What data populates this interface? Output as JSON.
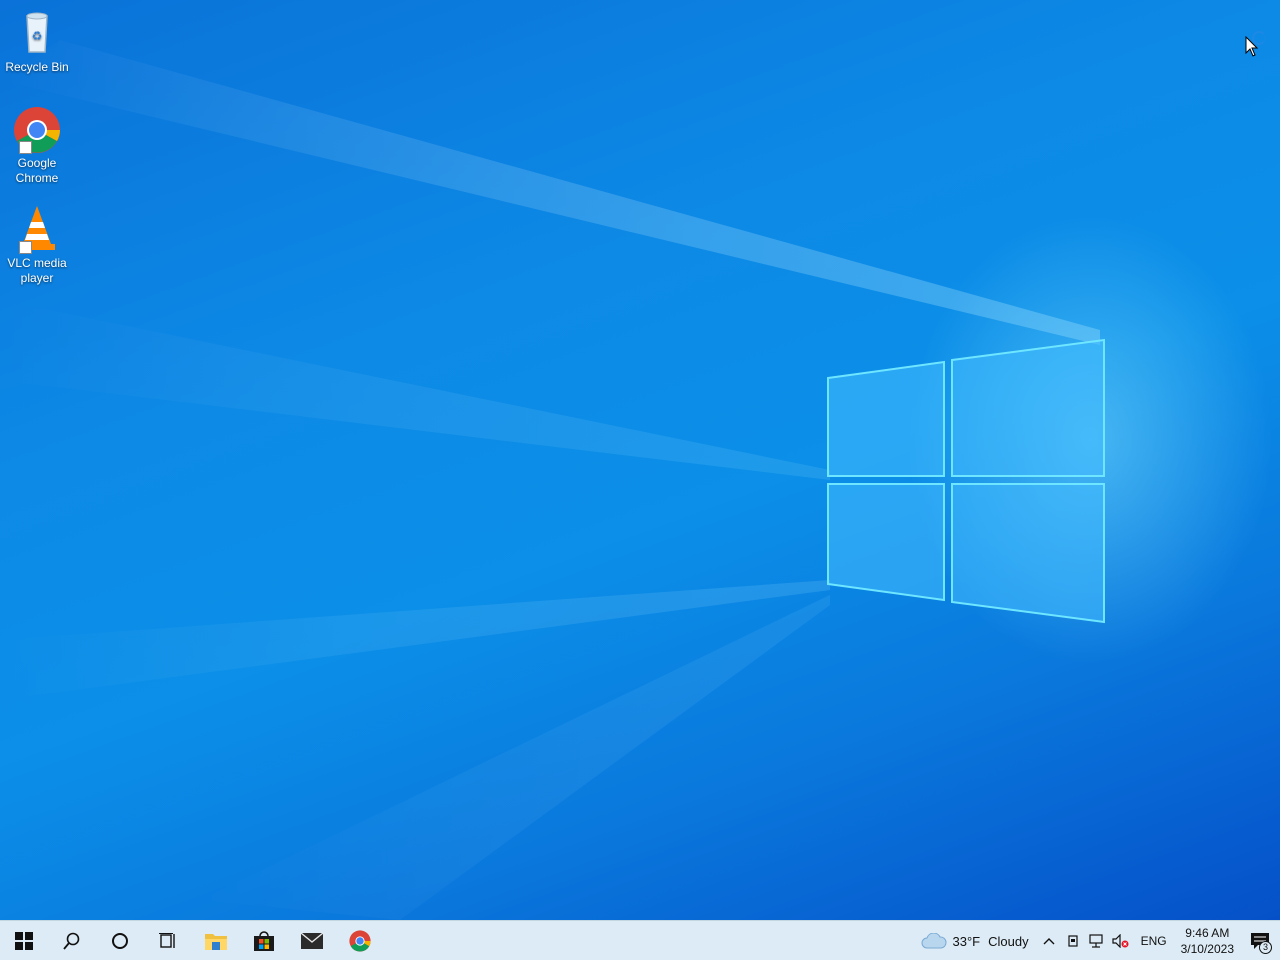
{
  "desktop": {
    "icons": [
      {
        "label": "Recycle Bin",
        "icon": "recycle-bin-icon"
      },
      {
        "label": "Google Chrome",
        "icon": "chrome-icon"
      },
      {
        "label": "VLC media player",
        "icon": "vlc-icon"
      }
    ]
  },
  "taskbar": {
    "buttons": [
      {
        "icon": "windows-start-icon"
      },
      {
        "icon": "search-icon"
      },
      {
        "icon": "cortana-icon"
      },
      {
        "icon": "task-view-icon"
      },
      {
        "icon": "file-explorer-icon"
      },
      {
        "icon": "microsoft-store-icon"
      },
      {
        "icon": "mail-icon"
      },
      {
        "icon": "chrome-icon"
      }
    ],
    "weather": {
      "temperature": "33°F",
      "condition": "Cloudy"
    },
    "language": "ENG",
    "clock": {
      "time": "9:46 AM",
      "date": "3/10/2023"
    },
    "notifications_count": "3"
  },
  "colors": {
    "taskbar_bg": "#dcebf5",
    "desktop_accent": "#0b8fe8"
  }
}
